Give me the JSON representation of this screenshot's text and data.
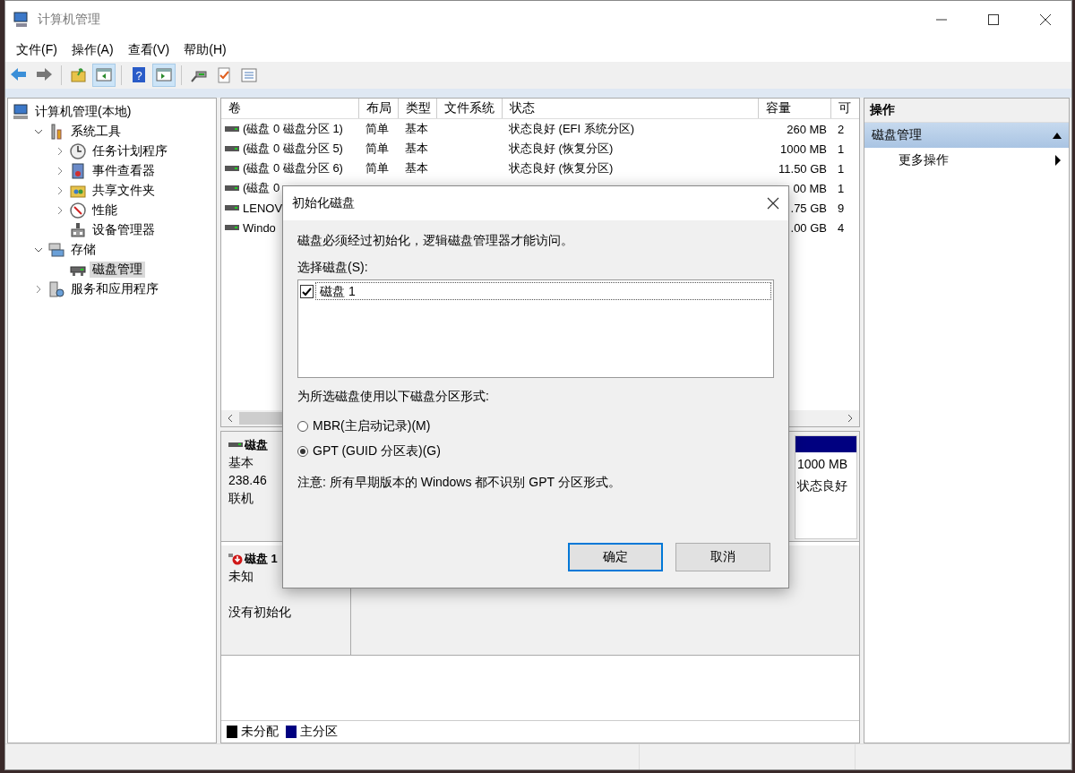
{
  "window": {
    "title": "计算机管理"
  },
  "menu": [
    {
      "label": "文件(F)"
    },
    {
      "label": "操作(A)"
    },
    {
      "label": "查看(V)"
    },
    {
      "label": "帮助(H)"
    }
  ],
  "toolbar": [
    {
      "kind": "back",
      "pressed": false
    },
    {
      "kind": "forward",
      "pressed": false
    },
    {
      "kind": "sep"
    },
    {
      "kind": "up",
      "pressed": false
    },
    {
      "kind": "tree",
      "pressed": true
    },
    {
      "kind": "sep"
    },
    {
      "kind": "help",
      "label": "?",
      "pressed": false
    },
    {
      "kind": "pane",
      "pressed": true
    },
    {
      "kind": "sep"
    },
    {
      "kind": "connect",
      "pressed": false
    },
    {
      "kind": "check",
      "pressed": false
    },
    {
      "kind": "list",
      "pressed": false
    }
  ],
  "tree": [
    {
      "label": "计算机管理(本地)",
      "kind": "computer",
      "selected": false,
      "children": [
        {
          "label": "系统工具",
          "kind": "tools",
          "expanded": true,
          "selected": false,
          "children": [
            {
              "label": "任务计划程序",
              "kind": "clock",
              "expanded": false,
              "selected": false
            },
            {
              "label": "事件查看器",
              "kind": "log",
              "expanded": false,
              "selected": false
            },
            {
              "label": "共享文件夹",
              "kind": "share",
              "expanded": false,
              "selected": false
            },
            {
              "label": "性能",
              "kind": "perf",
              "expanded": false,
              "selected": false
            },
            {
              "label": "设备管理器",
              "kind": "device",
              "selected": false
            }
          ]
        },
        {
          "label": "存储",
          "kind": "storage",
          "expanded": true,
          "selected": false,
          "children": [
            {
              "label": "磁盘管理",
              "kind": "disk",
              "selected": true
            }
          ]
        },
        {
          "label": "服务和应用程序",
          "kind": "services",
          "expanded": false,
          "selected": false
        }
      ]
    }
  ],
  "volumes": {
    "columns": [
      "卷",
      "布局",
      "类型",
      "文件系统",
      "状态",
      "容量",
      "可"
    ],
    "rows": [
      {
        "cells": [
          "(磁盘 0 磁盘分区 1)",
          "简单",
          "基本",
          null,
          "状态良好 (EFI 系统分区)",
          "260 MB",
          "2"
        ]
      },
      {
        "cells": [
          "(磁盘 0 磁盘分区 5)",
          "简单",
          "基本",
          null,
          "状态良好 (恢复分区)",
          "1000 MB",
          "1"
        ]
      },
      {
        "cells": [
          "(磁盘 0 磁盘分区 6)",
          "简单",
          "基本",
          null,
          "状态良好 (恢复分区)",
          "11.50 GB",
          "1"
        ]
      },
      {
        "cells": [
          "(磁盘 0",
          null,
          null,
          null,
          null,
          "00 MB",
          "1"
        ]
      },
      {
        "cells": [
          "LENOV",
          null,
          null,
          null,
          null,
          ".75 GB",
          "9"
        ]
      },
      {
        "cells": [
          "Windo",
          null,
          null,
          null,
          null,
          ".00 GB",
          "4"
        ]
      }
    ]
  },
  "disks": [
    {
      "kind": "online",
      "name": "磁盘",
      "lines": [
        "基本",
        "238.46",
        "联机"
      ],
      "partition": {
        "size": "1000 MB",
        "status": "状态良好",
        "color": "#000080"
      }
    },
    {
      "kind": "error",
      "name": "磁盘 1",
      "lines": [
        "未知"
      ],
      "note": "没有初始化"
    }
  ],
  "legend": [
    {
      "label": "未分配",
      "color": "#000000"
    },
    {
      "label": "主分区",
      "color": "#000080"
    }
  ],
  "actions": {
    "title": "操作",
    "items": [
      {
        "kind": "header",
        "label": "磁盘管理",
        "expanded": true
      },
      {
        "kind": "submenu",
        "label": "更多操作"
      }
    ]
  },
  "dialog": {
    "title": "初始化磁盘",
    "message": "磁盘必须经过初始化，逻辑磁盘管理器才能访问。",
    "list_label": "选择磁盘(S):",
    "disks": [
      {
        "label": "磁盘 1",
        "checked": true
      }
    ],
    "style_label": "为所选磁盘使用以下磁盘分区形式:",
    "options": [
      {
        "label": "MBR(主启动记录)(M)",
        "selected": false
      },
      {
        "label": "GPT (GUID 分区表)(G)",
        "selected": true
      }
    ],
    "note": "注意: 所有早期版本的 Windows 都不识别 GPT 分区形式。",
    "buttons": [
      {
        "label": "确定",
        "default": true
      },
      {
        "label": "取消",
        "default": false
      }
    ]
  }
}
